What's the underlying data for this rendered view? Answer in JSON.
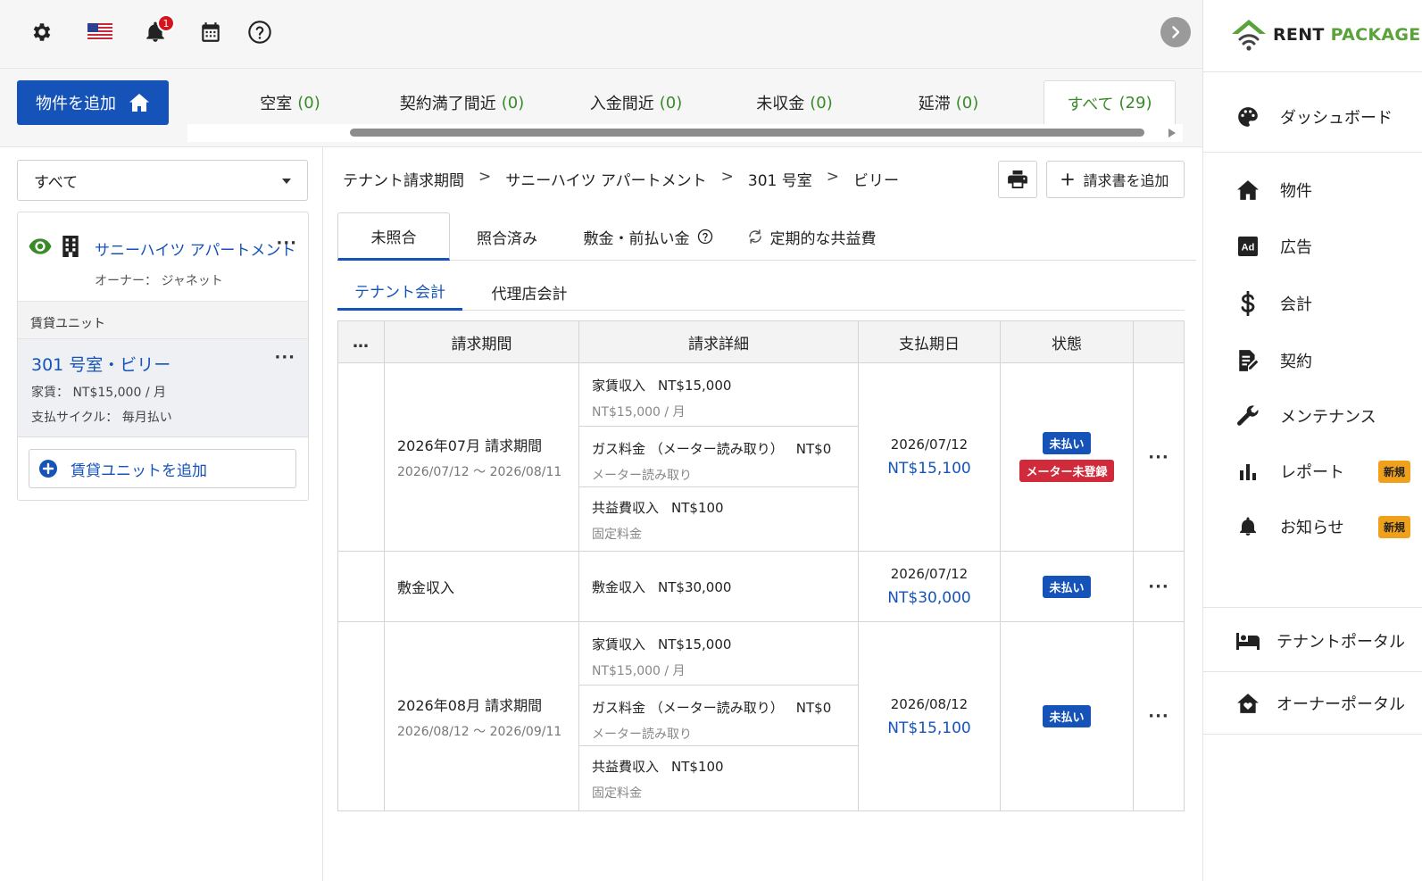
{
  "topbar": {
    "notification_count": "1"
  },
  "status_tabs": {
    "add_property_label": "物件を追加",
    "tabs": [
      {
        "label": "空室",
        "count": "(0)"
      },
      {
        "label": "契約満了間近",
        "count": "(0)"
      },
      {
        "label": "入金間近",
        "count": "(0)"
      },
      {
        "label": "未収金",
        "count": "(0)"
      },
      {
        "label": "延滞",
        "count": "(0)"
      },
      {
        "label": "すべて",
        "count": "(29)"
      }
    ]
  },
  "left_panel": {
    "filter_value": "すべて",
    "property": {
      "name": "サニーハイツ アパートメント",
      "owner_label": "オーナー：",
      "owner_name": "ジャネット"
    },
    "units_label": "賃貸ユニット",
    "unit": {
      "name": "301 号室・ビリー",
      "rent": "家賃： NT$15,000 / 月",
      "cycle": "支払サイクル： 毎月払い"
    },
    "add_unit_label": "賃貸ユニットを追加"
  },
  "breadcrumb": [
    "テナント請求期間",
    "サニーハイツ アパートメント",
    "301 号室",
    "ビリー"
  ],
  "breadcrumb_sep": ">",
  "actions": {
    "add_invoice_label": "請求書を追加"
  },
  "tabs_primary": [
    "未照合",
    "照合済み",
    "敷金・前払い金",
    "定期的な共益費"
  ],
  "tabs_secondary": [
    "テナント会計",
    "代理店会計"
  ],
  "table": {
    "headers": [
      "…",
      "請求期間",
      "請求詳細",
      "支払期日",
      "状態"
    ],
    "rows": [
      {
        "period": "2026年07月 請求期間",
        "range": "2026/07/12 ～ 2026/08/11",
        "details": [
          {
            "name": "家賃収入",
            "amount": "NT$15,000",
            "sub": "NT$15,000 / 月"
          },
          {
            "name": "ガス料金 （メーター読み取り）",
            "amount": "NT$0",
            "sub": "メーター読み取り"
          },
          {
            "name": "共益費収入",
            "amount": "NT$100",
            "sub": "固定料金"
          }
        ],
        "due_date": "2026/07/12",
        "due_amount": "NT$15,100",
        "badges": [
          "未払い",
          "メーター未登録"
        ]
      },
      {
        "period": "敷金収入",
        "range": "",
        "details": [
          {
            "name": "敷金収入",
            "amount": "NT$30,000",
            "sub": ""
          }
        ],
        "due_date": "2026/07/12",
        "due_amount": "NT$30,000",
        "badges": [
          "未払い"
        ]
      },
      {
        "period": "2026年08月 請求期間",
        "range": "2026/08/12 ～ 2026/09/11",
        "details": [
          {
            "name": "家賃収入",
            "amount": "NT$15,000",
            "sub": "NT$15,000 / 月"
          },
          {
            "name": "ガス料金 （メーター読み取り）",
            "amount": "NT$0",
            "sub": "メーター読み取り"
          },
          {
            "name": "共益費収入",
            "amount": "NT$100",
            "sub": "固定料金"
          }
        ],
        "due_date": "2026/08/12",
        "due_amount": "NT$15,100",
        "badges": [
          "未払い"
        ]
      }
    ]
  },
  "sidebar": {
    "logo_main": "RENT",
    "logo_accent": "PACKAGE",
    "nav": [
      {
        "label": "ダッシュボード",
        "icon": "palette-icon"
      },
      {
        "label": "物件",
        "icon": "home-icon"
      },
      {
        "label": "広告",
        "icon": "ad-icon"
      },
      {
        "label": "会計",
        "icon": "dollar-icon"
      },
      {
        "label": "契約",
        "icon": "contract-icon"
      },
      {
        "label": "メンテナンス",
        "icon": "wrench-icon"
      },
      {
        "label": "レポート",
        "icon": "bar-chart-icon",
        "badge": "新規"
      },
      {
        "label": "お知らせ",
        "icon": "bell-icon",
        "badge": "新規"
      }
    ],
    "portals": [
      {
        "label": "テナントポータル",
        "icon": "bed-icon"
      },
      {
        "label": "オーナーポータル",
        "icon": "house-heart-icon"
      }
    ]
  },
  "colors": {
    "primary": "#1553b8",
    "accent_green": "#3a8a2a",
    "badge_red": "#d12b3b",
    "new_badge": "#f0a11c"
  }
}
